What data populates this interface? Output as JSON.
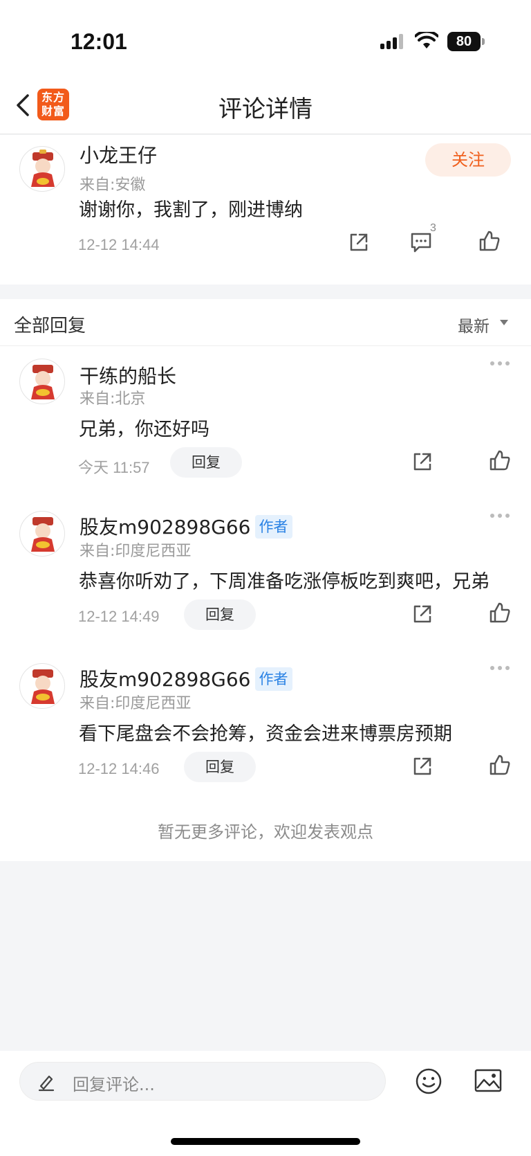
{
  "status_bar": {
    "time": "12:01",
    "battery": "80"
  },
  "nav": {
    "title": "评论详情",
    "logo_line1": "东方",
    "logo_line2": "财富"
  },
  "main_comment": {
    "username": "小龙王仔",
    "from": "来自:安徽",
    "text": "谢谢你，我割了，刚进博纳",
    "time": "12-12 14:44",
    "follow_label": "关注",
    "reply_count": "3"
  },
  "replies": {
    "title": "全部回复",
    "sort_label": "最新",
    "items": [
      {
        "username": "干练的船长",
        "badge": "",
        "from": "来自:北京",
        "text": "兄弟，你还好吗",
        "time": "今天 11:57",
        "reply_label": "回复"
      },
      {
        "username": "股友m902898G66",
        "badge": "作者",
        "from": "来自:印度尼西亚",
        "text": "恭喜你听劝了，下周准备吃涨停板吃到爽吧，兄弟",
        "time": "12-12 14:49",
        "reply_label": "回复"
      },
      {
        "username": "股友m902898G66",
        "badge": "作者",
        "from": "来自:印度尼西亚",
        "text": "看下尾盘会不会抢筹，资金会进来博票房预期",
        "time": "12-12 14:46",
        "reply_label": "回复"
      }
    ],
    "footer_note": "暂无更多评论，欢迎发表观点"
  },
  "bottom_bar": {
    "placeholder": "回复评论..."
  },
  "colors": {
    "accent": "#f25a1a",
    "follow_bg": "#fdeee6",
    "author_badge": "#2a82e4"
  },
  "icons": [
    "back-icon",
    "share-icon",
    "comment-icon",
    "like-icon",
    "more-icon",
    "pen-icon",
    "emoji-icon",
    "image-icon"
  ]
}
